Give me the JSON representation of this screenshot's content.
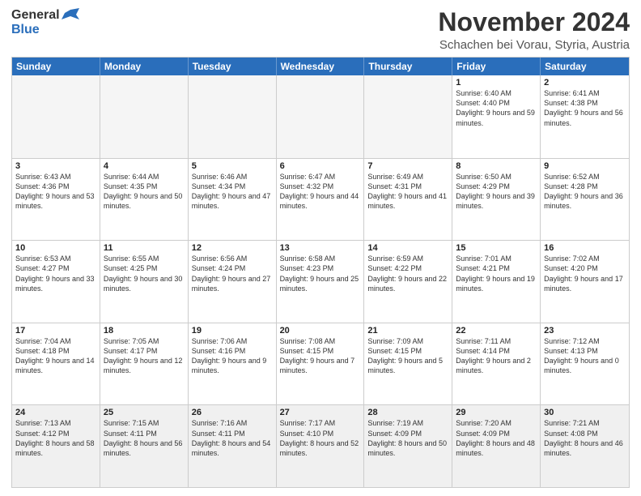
{
  "header": {
    "logo_general": "General",
    "logo_blue": "Blue",
    "month_year": "November 2024",
    "location": "Schachen bei Vorau, Styria, Austria"
  },
  "days_of_week": [
    "Sunday",
    "Monday",
    "Tuesday",
    "Wednesday",
    "Thursday",
    "Friday",
    "Saturday"
  ],
  "weeks": [
    [
      {
        "day": "",
        "empty": true
      },
      {
        "day": "",
        "empty": true
      },
      {
        "day": "",
        "empty": true
      },
      {
        "day": "",
        "empty": true
      },
      {
        "day": "",
        "empty": true
      },
      {
        "day": "1",
        "text": "Sunrise: 6:40 AM\nSunset: 4:40 PM\nDaylight: 9 hours and 59 minutes."
      },
      {
        "day": "2",
        "text": "Sunrise: 6:41 AM\nSunset: 4:38 PM\nDaylight: 9 hours and 56 minutes."
      }
    ],
    [
      {
        "day": "3",
        "text": "Sunrise: 6:43 AM\nSunset: 4:36 PM\nDaylight: 9 hours and 53 minutes."
      },
      {
        "day": "4",
        "text": "Sunrise: 6:44 AM\nSunset: 4:35 PM\nDaylight: 9 hours and 50 minutes."
      },
      {
        "day": "5",
        "text": "Sunrise: 6:46 AM\nSunset: 4:34 PM\nDaylight: 9 hours and 47 minutes."
      },
      {
        "day": "6",
        "text": "Sunrise: 6:47 AM\nSunset: 4:32 PM\nDaylight: 9 hours and 44 minutes."
      },
      {
        "day": "7",
        "text": "Sunrise: 6:49 AM\nSunset: 4:31 PM\nDaylight: 9 hours and 41 minutes."
      },
      {
        "day": "8",
        "text": "Sunrise: 6:50 AM\nSunset: 4:29 PM\nDaylight: 9 hours and 39 minutes."
      },
      {
        "day": "9",
        "text": "Sunrise: 6:52 AM\nSunset: 4:28 PM\nDaylight: 9 hours and 36 minutes."
      }
    ],
    [
      {
        "day": "10",
        "text": "Sunrise: 6:53 AM\nSunset: 4:27 PM\nDaylight: 9 hours and 33 minutes."
      },
      {
        "day": "11",
        "text": "Sunrise: 6:55 AM\nSunset: 4:25 PM\nDaylight: 9 hours and 30 minutes."
      },
      {
        "day": "12",
        "text": "Sunrise: 6:56 AM\nSunset: 4:24 PM\nDaylight: 9 hours and 27 minutes."
      },
      {
        "day": "13",
        "text": "Sunrise: 6:58 AM\nSunset: 4:23 PM\nDaylight: 9 hours and 25 minutes."
      },
      {
        "day": "14",
        "text": "Sunrise: 6:59 AM\nSunset: 4:22 PM\nDaylight: 9 hours and 22 minutes."
      },
      {
        "day": "15",
        "text": "Sunrise: 7:01 AM\nSunset: 4:21 PM\nDaylight: 9 hours and 19 minutes."
      },
      {
        "day": "16",
        "text": "Sunrise: 7:02 AM\nSunset: 4:20 PM\nDaylight: 9 hours and 17 minutes."
      }
    ],
    [
      {
        "day": "17",
        "text": "Sunrise: 7:04 AM\nSunset: 4:18 PM\nDaylight: 9 hours and 14 minutes."
      },
      {
        "day": "18",
        "text": "Sunrise: 7:05 AM\nSunset: 4:17 PM\nDaylight: 9 hours and 12 minutes."
      },
      {
        "day": "19",
        "text": "Sunrise: 7:06 AM\nSunset: 4:16 PM\nDaylight: 9 hours and 9 minutes."
      },
      {
        "day": "20",
        "text": "Sunrise: 7:08 AM\nSunset: 4:15 PM\nDaylight: 9 hours and 7 minutes."
      },
      {
        "day": "21",
        "text": "Sunrise: 7:09 AM\nSunset: 4:15 PM\nDaylight: 9 hours and 5 minutes."
      },
      {
        "day": "22",
        "text": "Sunrise: 7:11 AM\nSunset: 4:14 PM\nDaylight: 9 hours and 2 minutes."
      },
      {
        "day": "23",
        "text": "Sunrise: 7:12 AM\nSunset: 4:13 PM\nDaylight: 9 hours and 0 minutes."
      }
    ],
    [
      {
        "day": "24",
        "text": "Sunrise: 7:13 AM\nSunset: 4:12 PM\nDaylight: 8 hours and 58 minutes."
      },
      {
        "day": "25",
        "text": "Sunrise: 7:15 AM\nSunset: 4:11 PM\nDaylight: 8 hours and 56 minutes."
      },
      {
        "day": "26",
        "text": "Sunrise: 7:16 AM\nSunset: 4:11 PM\nDaylight: 8 hours and 54 minutes."
      },
      {
        "day": "27",
        "text": "Sunrise: 7:17 AM\nSunset: 4:10 PM\nDaylight: 8 hours and 52 minutes."
      },
      {
        "day": "28",
        "text": "Sunrise: 7:19 AM\nSunset: 4:09 PM\nDaylight: 8 hours and 50 minutes."
      },
      {
        "day": "29",
        "text": "Sunrise: 7:20 AM\nSunset: 4:09 PM\nDaylight: 8 hours and 48 minutes."
      },
      {
        "day": "30",
        "text": "Sunrise: 7:21 AM\nSunset: 4:08 PM\nDaylight: 8 hours and 46 minutes."
      }
    ]
  ]
}
